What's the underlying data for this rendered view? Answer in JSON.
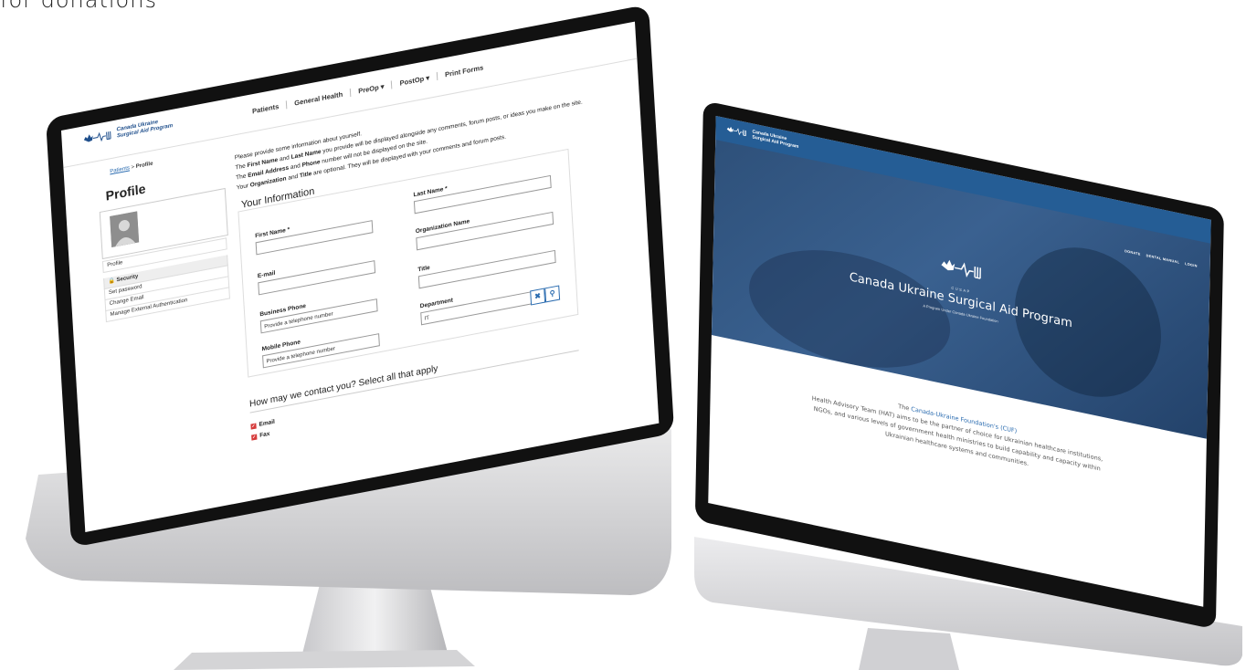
{
  "caption": "for donations",
  "left": {
    "logo": {
      "line1": "Canada Ukraine",
      "line2": "Surgical Aid Program"
    },
    "nav": [
      "Patients",
      "General Health",
      "PreOp ▾",
      "PostOp ▾",
      "Print Forms"
    ],
    "breadcrumb": {
      "link": "Patients",
      "sep": ">",
      "current": "Profile"
    },
    "title": "Profile",
    "side_menu": {
      "profile": "Profile",
      "security": "Security",
      "set_password": "Set password",
      "change_email": "Change Email",
      "manage_ext": "Manage External Authentication"
    },
    "intro": {
      "line1": "Please provide some information about yourself.",
      "line2a": "The ",
      "first_name": "First Name",
      "line2b": " and ",
      "last_name": "Last Name",
      "line2c": " you provide will be displayed alongside any comments, forum posts, or ideas you make on the site.",
      "line3a": "The ",
      "email_address": "Email Address",
      "line3b": " and ",
      "phone": "Phone",
      "line3c": " number will not be displayed on the site.",
      "line4a": "Your ",
      "organization": "Organization",
      "line4b": " and ",
      "title_word": "Title",
      "line4c": " are optional. They will be displayed with your comments and forum posts."
    },
    "form_title": "Your Information",
    "fields": {
      "first_name": {
        "label": "First Name *",
        "value": ""
      },
      "last_name": {
        "label": "Last Name *",
        "value": ""
      },
      "email": {
        "label": "E-mail",
        "value": ""
      },
      "org": {
        "label": "Organization Name",
        "value": ""
      },
      "business_phone": {
        "label": "Business Phone",
        "placeholder": "Provide a telephone number"
      },
      "title": {
        "label": "Title",
        "value": ""
      },
      "mobile_phone": {
        "label": "Mobile Phone",
        "placeholder": "Provide a telephone number"
      },
      "department": {
        "label": "Department",
        "value": "IT"
      }
    },
    "contact_title": "How may we contact you? Select all that apply",
    "contact_options": [
      "Email",
      "Fax"
    ]
  },
  "right": {
    "logo": {
      "line1": "Canada Ukraine",
      "line2": "Surgical Aid Program"
    },
    "nav": [
      "DONATE",
      "DENTAL MANUAL",
      "LOGIN"
    ],
    "hero_small": "CUSAP",
    "hero_title": "Canada Ukraine Surgical Aid Program",
    "hero_tag": "A Program Under Canada-Ukraine Foundation",
    "body": {
      "pre": "The ",
      "link": "Canada-Ukraine Foundation's (CUF)",
      "rest": "Health Advisory Team (HAT) aims to be the partner of choice for Ukrainian healthcare institutions, NGOs, and various levels of government health ministries to build capability and capacity within Ukrainian healthcare systems and communities."
    }
  },
  "colors": {
    "brand_blue": "#255d95",
    "link_blue": "#2b6cb0",
    "check_red": "#d63b3b"
  }
}
